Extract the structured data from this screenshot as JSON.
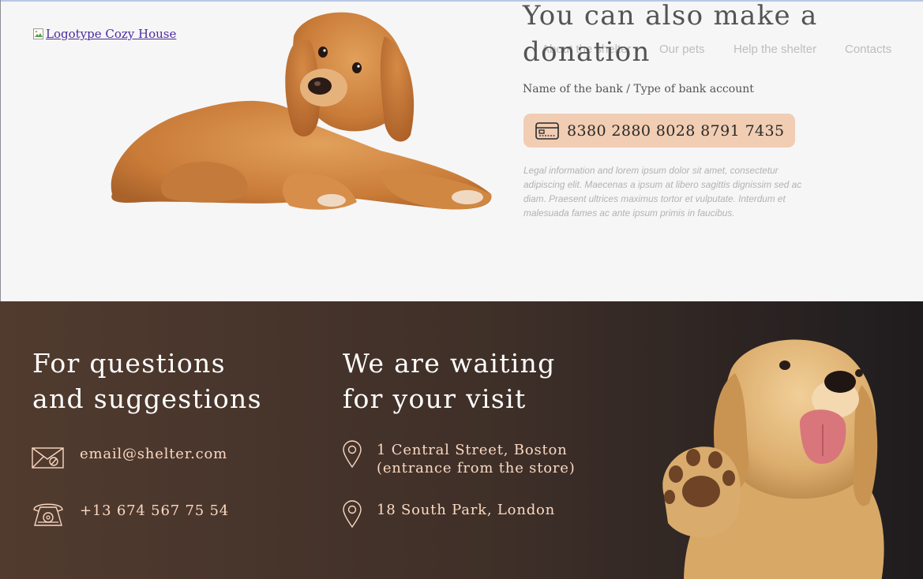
{
  "logo": {
    "alt": "Logotype Cozy House"
  },
  "nav": {
    "items": [
      "About the shelter",
      "Our pets",
      "Help the shelter",
      "Contacts"
    ]
  },
  "donation": {
    "title": "You can also make a donation",
    "bank_label": "Name of the bank / Type of bank account",
    "account_number": "8380 2880 8028 8791 7435",
    "legal_text": "Legal information and lorem ipsum dolor sit amet, consectetur adipiscing elit. Maecenas a ipsum at libero sagittis dignissim sed ac diam. Praesent ultrices maximus tortor et vulputate. Interdum et malesuada fames ac ante ipsum primis in faucibus.",
    "account_color": "#f1cdb3"
  },
  "contacts": {
    "questions_title_line1": "For questions",
    "questions_title_line2": "and suggestions",
    "email": "email@shelter.com",
    "phone": "+13 674 567 75 54",
    "visit_title_line1": "We are waiting",
    "visit_title_line2": "for your visit",
    "address1_line1": "1 Central Street, Boston",
    "address1_line2": "(entrance from the store)",
    "address2": "18 South Park, London",
    "accent_color": "#fad8c1"
  },
  "icons": {
    "logo": "broken-image-icon",
    "card": "credit-card-icon",
    "email": "envelope-icon",
    "phone": "telephone-icon",
    "location": "map-pin-icon"
  }
}
